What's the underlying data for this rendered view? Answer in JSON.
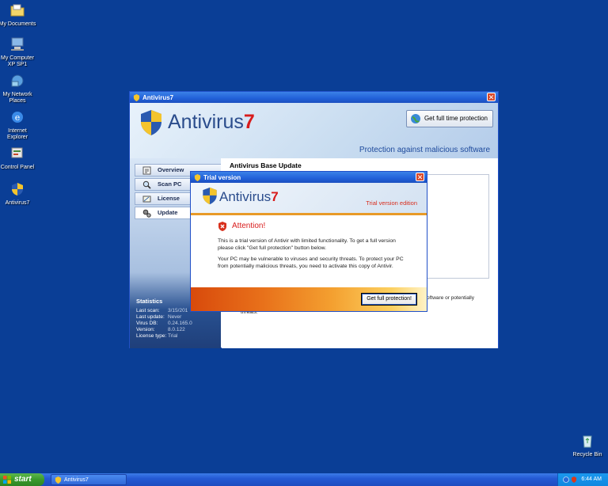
{
  "desktop": {
    "icons": [
      {
        "label": "My Documents"
      },
      {
        "label": "My Computer\nXP SP1"
      },
      {
        "label": "My Network\nPlaces"
      },
      {
        "label": "Internet\nExplorer"
      },
      {
        "label": "Control Panel"
      },
      {
        "label": "Antivirus7"
      },
      {
        "label": "Recycle Bin"
      }
    ]
  },
  "main_window": {
    "title": "Antivirus7",
    "logo_name": "Antivirus",
    "logo_number": "7",
    "full_protection_label": "Get full time protection",
    "tagline": "Protection against malicious software",
    "nav": [
      {
        "label": "Overview"
      },
      {
        "label": "Scan PC"
      },
      {
        "label": "License"
      },
      {
        "label": "Update"
      }
    ],
    "content_title": "Antivirus Base Update",
    "content_text_right": "oftware or potentially",
    "content_text_line2": "threats.",
    "statistics": {
      "title": "Statistics",
      "rows": [
        {
          "key": "Last scan:",
          "value": "3/15/201"
        },
        {
          "key": "Last update:",
          "value": "Never"
        },
        {
          "key": "Virus DB:",
          "value": "0.24.165.0"
        },
        {
          "key": "Version:",
          "value": "8.0.122"
        },
        {
          "key": "License type:",
          "value": "Trial"
        }
      ]
    },
    "colors": {
      "accent_red": "#d81c1c",
      "brand_blue": "#2a4c8c"
    }
  },
  "dialog": {
    "title": "Trial version",
    "logo_name": "Antivirus",
    "logo_number": "7",
    "edition": "Trial version edition",
    "attention": "Attention!",
    "paragraph1": "This is a trial version of Antivir with limited functionality. To get a full version please click \"Get full protection\" button below.",
    "paragraph2": "Your PC may be vulnerable to viruses and security threats. To protect your PC from potentially malicious threats, you need to activate this copy of Antivir.",
    "button_label": "Get full protection!"
  },
  "taskbar": {
    "start_label": "start",
    "task_label": "Antivirus7",
    "clock": "6:44 AM"
  }
}
